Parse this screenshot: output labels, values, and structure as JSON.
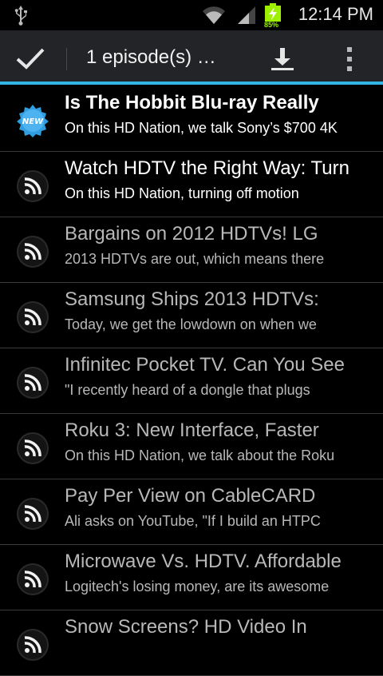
{
  "status_bar": {
    "time": "12:14 PM",
    "battery_percent": "85%",
    "icons": [
      "usb-icon",
      "wifi-icon",
      "signal-icon",
      "battery-charging-icon"
    ]
  },
  "action_bar": {
    "title": "1 episode(s) …",
    "accent_color": "#33b5e5",
    "icons": [
      "check-icon",
      "download-icon",
      "overflow-menu-icon"
    ]
  },
  "episodes": [
    {
      "title": "Is The Hobbit Blu-ray Really",
      "description": "On this HD Nation, we talk Sony’s $700 4K",
      "icon": "new-badge-icon",
      "bright": true
    },
    {
      "title": "Watch HDTV the Right Way: Turn",
      "description": "On this HD Nation, turning off motion",
      "icon": "rss-icon",
      "bright": true
    },
    {
      "title": "Bargains on 2012 HDTVs! LG",
      "description": "2013 HDTVs are out, which means there",
      "icon": "rss-icon",
      "bright": false
    },
    {
      "title": "Samsung Ships 2013 HDTVs:",
      "description": "Today, we get the lowdown on when we",
      "icon": "rss-icon",
      "bright": false
    },
    {
      "title": "Infinitec Pocket TV. Can You See",
      "description": "\"I recently heard of a dongle that plugs",
      "icon": "rss-icon",
      "bright": false
    },
    {
      "title": "Roku 3: New Interface, Faster",
      "description": "On this HD Nation, we talk about the Roku",
      "icon": "rss-icon",
      "bright": false
    },
    {
      "title": "Pay Per View on CableCARD",
      "description": "Ali asks on YouTube, \"If I build an HTPC",
      "icon": "rss-icon",
      "bright": false
    },
    {
      "title": "Microwave Vs. HDTV. Affordable",
      "description": "Logitech's losing money, are its awesome",
      "icon": "rss-icon",
      "bright": false
    },
    {
      "title": "Snow Screens?  HD Video In",
      "description": "",
      "icon": "rss-icon",
      "bright": false
    }
  ]
}
